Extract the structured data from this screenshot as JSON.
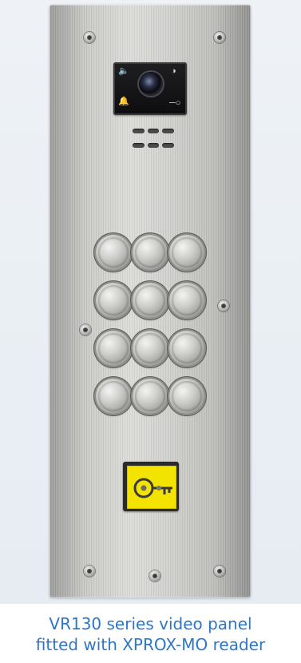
{
  "product": {
    "caption_line1": "VR130 series video panel",
    "caption_line2": "fitted with XPROX-MO reader"
  },
  "panel": {
    "finish": "brushed-stainless-steel",
    "key_count": 12,
    "camera_indicators": [
      "mute-speaker-icon",
      "talk-icon",
      "bell-icon",
      "key-icon"
    ],
    "reader_color": "#f3e300",
    "caption_color": "#2f76c7"
  }
}
